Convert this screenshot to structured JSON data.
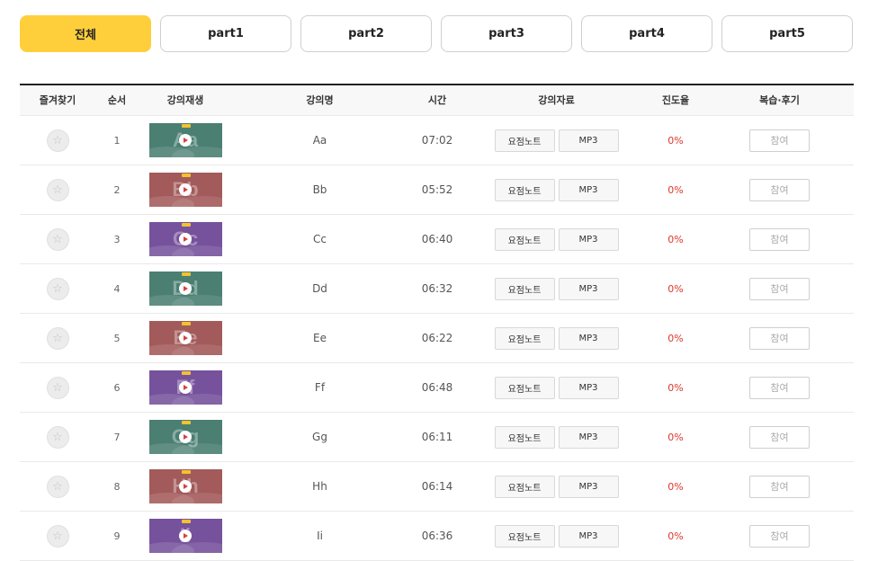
{
  "tabs": [
    {
      "label": "전체",
      "active": true
    },
    {
      "label": "part1",
      "active": false
    },
    {
      "label": "part2",
      "active": false
    },
    {
      "label": "part3",
      "active": false
    },
    {
      "label": "part4",
      "active": false
    },
    {
      "label": "part5",
      "active": false
    }
  ],
  "table": {
    "headers": {
      "favorite": "즐겨찾기",
      "order": "순서",
      "play": "강의재생",
      "name": "강의명",
      "time": "시간",
      "materials": "강의자료",
      "progress": "진도율",
      "review": "복습·후기"
    },
    "rows": [
      {
        "order": "1",
        "name": "Aa",
        "time": "07:02",
        "note": "요점노트",
        "mp3": "MP3",
        "progress": "0%",
        "join": "참여",
        "thumb_letter": "Aa",
        "thumb_color": "#4a7f72"
      },
      {
        "order": "2",
        "name": "Bb",
        "time": "05:52",
        "note": "요점노트",
        "mp3": "MP3",
        "progress": "0%",
        "join": "참여",
        "thumb_letter": "Bb",
        "thumb_color": "#a35a5a"
      },
      {
        "order": "3",
        "name": "Cc",
        "time": "06:40",
        "note": "요점노트",
        "mp3": "MP3",
        "progress": "0%",
        "join": "참여",
        "thumb_letter": "Cc",
        "thumb_color": "#76529c"
      },
      {
        "order": "4",
        "name": "Dd",
        "time": "06:32",
        "note": "요점노트",
        "mp3": "MP3",
        "progress": "0%",
        "join": "참여",
        "thumb_letter": "Dd",
        "thumb_color": "#4a7f72"
      },
      {
        "order": "5",
        "name": "Ee",
        "time": "06:22",
        "note": "요점노트",
        "mp3": "MP3",
        "progress": "0%",
        "join": "참여",
        "thumb_letter": "Ee",
        "thumb_color": "#a35a5a"
      },
      {
        "order": "6",
        "name": "Ff",
        "time": "06:48",
        "note": "요점노트",
        "mp3": "MP3",
        "progress": "0%",
        "join": "참여",
        "thumb_letter": "Ff",
        "thumb_color": "#76529c"
      },
      {
        "order": "7",
        "name": "Gg",
        "time": "06:11",
        "note": "요점노트",
        "mp3": "MP3",
        "progress": "0%",
        "join": "참여",
        "thumb_letter": "Gg",
        "thumb_color": "#4a7f72"
      },
      {
        "order": "8",
        "name": "Hh",
        "time": "06:14",
        "note": "요점노트",
        "mp3": "MP3",
        "progress": "0%",
        "join": "참여",
        "thumb_letter": "Hh",
        "thumb_color": "#a35a5a"
      },
      {
        "order": "9",
        "name": "Ii",
        "time": "06:36",
        "note": "요점노트",
        "mp3": "MP3",
        "progress": "0%",
        "join": "참여",
        "thumb_letter": "Ii",
        "thumb_color": "#76529c"
      }
    ]
  },
  "icons": {
    "favorite": "star-icon",
    "play": "play-icon"
  },
  "colors": {
    "accent": "#ffcf3b",
    "progress": "#e0352b"
  }
}
